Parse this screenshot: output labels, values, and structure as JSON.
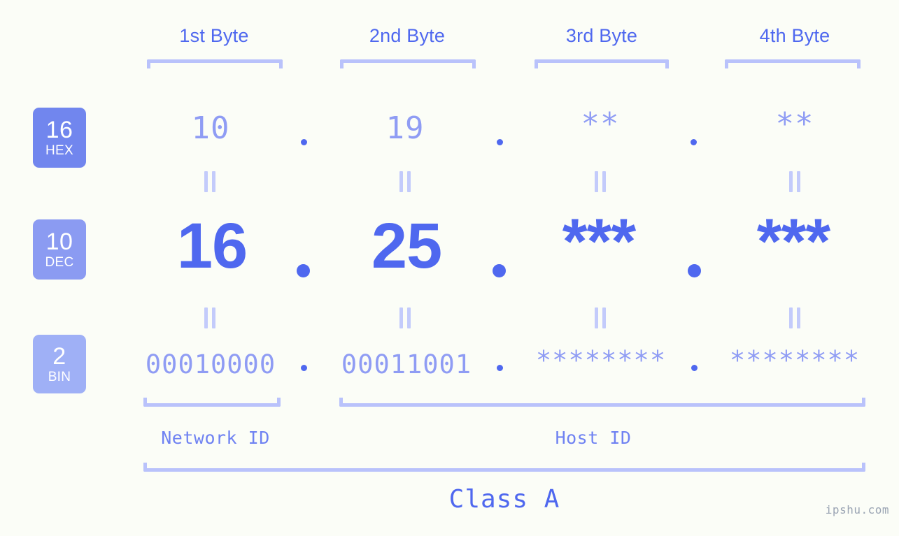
{
  "meta": {
    "background_color": "#fbfdf7",
    "accent_color": "#4f68ef",
    "light_accent_color": "#8f9cf4",
    "bracket_color": "#b9c2fb",
    "watermark": "ipshu.com"
  },
  "byte_headers": [
    {
      "label": "1st Byte"
    },
    {
      "label": "2nd Byte"
    },
    {
      "label": "3rd Byte"
    },
    {
      "label": "4th Byte"
    }
  ],
  "bases": [
    {
      "number": "16",
      "abbr": "HEX",
      "color": "#7186ee"
    },
    {
      "number": "10",
      "abbr": "DEC",
      "color": "#8b9bf2"
    },
    {
      "number": "2",
      "abbr": "BIN",
      "color": "#9fb0f6"
    }
  ],
  "rows": {
    "hex": {
      "name": "HEX",
      "values": [
        "10",
        "19",
        "**",
        "**"
      ],
      "separator": "."
    },
    "dec": {
      "name": "DEC",
      "values": [
        "16",
        "25",
        "***",
        "***"
      ],
      "separator": "."
    },
    "bin": {
      "name": "BIN",
      "values": [
        "00010000",
        "00011001",
        "********",
        "********"
      ],
      "separator": "."
    }
  },
  "equals_symbol": "=",
  "sections": [
    {
      "label": "Network ID"
    },
    {
      "label": "Host ID"
    }
  ],
  "class": {
    "label": "Class A"
  }
}
